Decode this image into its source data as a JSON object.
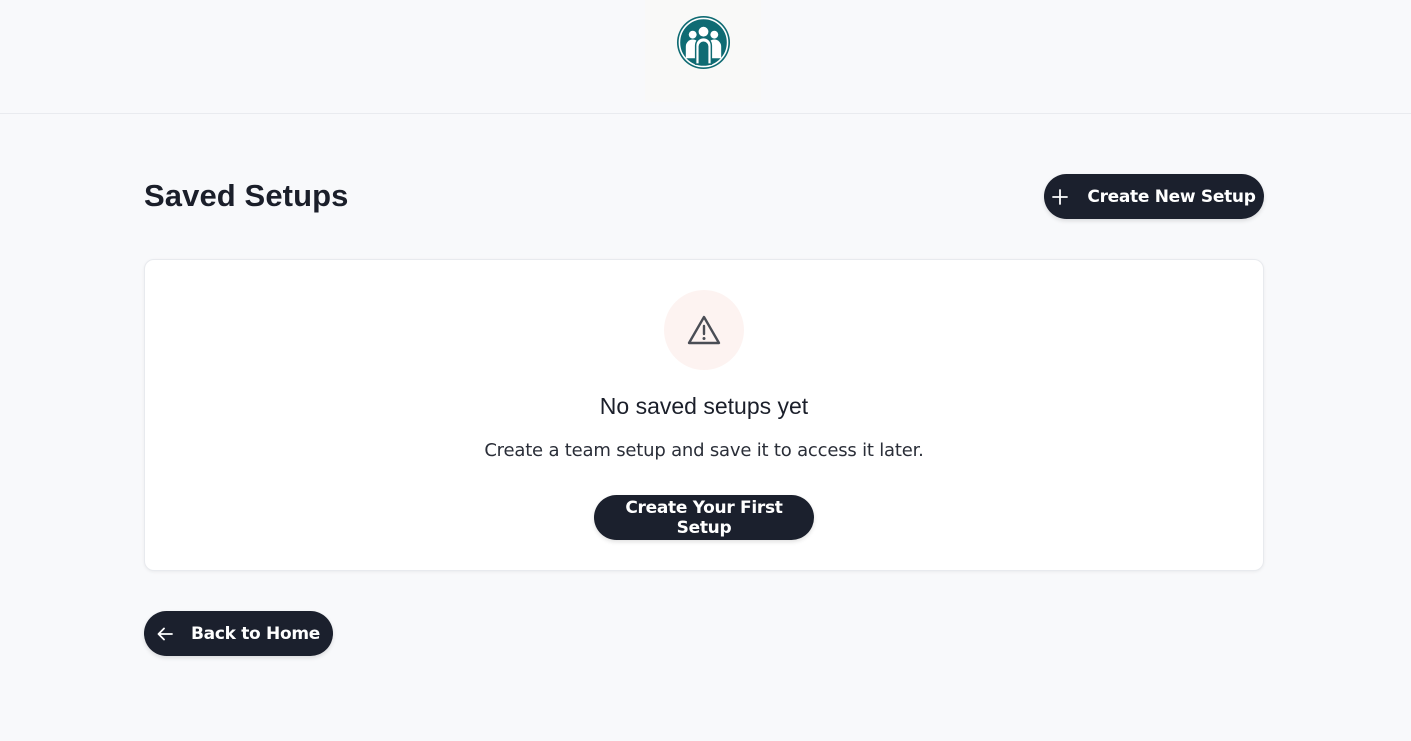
{
  "header": {
    "logo_icon": "team-people-icon",
    "brand_color": "#0f6b73"
  },
  "page": {
    "title": "Saved Setups"
  },
  "toolbar": {
    "create_new_label": "Create New Setup",
    "create_new_icon": "plus-icon"
  },
  "empty_state": {
    "icon": "warning-triangle-icon",
    "title": "No saved setups yet",
    "description": "Create a team setup and save it to access it later.",
    "cta_label": "Create Your First Setup"
  },
  "footer": {
    "back_label": "Back to Home",
    "back_icon": "arrow-left-icon"
  },
  "colors": {
    "button_bg": "#1b202d",
    "page_bg": "#f8f9fb",
    "warning_bg": "#fdf3f1"
  }
}
